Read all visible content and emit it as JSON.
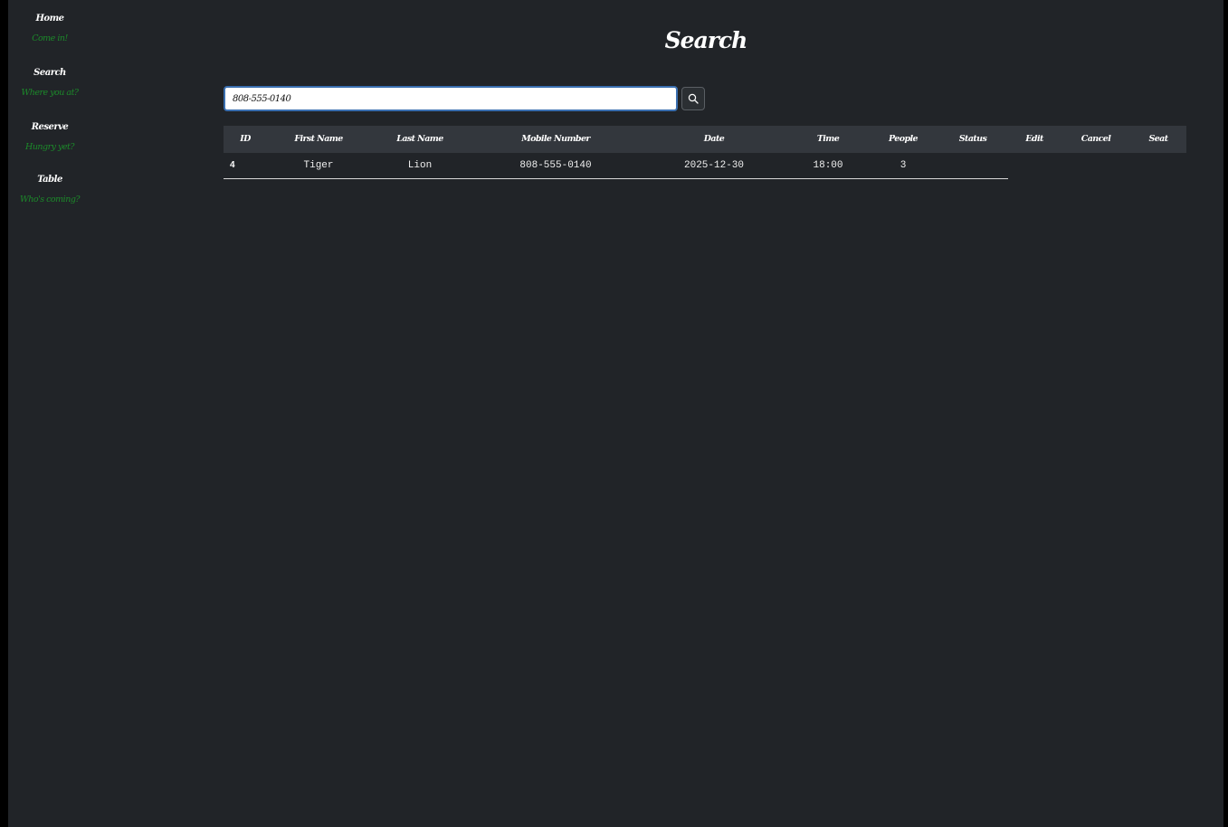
{
  "sidebar": {
    "items": [
      {
        "title": "Home",
        "subtitle": "Come in!"
      },
      {
        "title": "Search",
        "subtitle": "Where you at?"
      },
      {
        "title": "Reserve",
        "subtitle": "Hungry yet?"
      },
      {
        "title": "Table",
        "subtitle": "Who's coming?"
      }
    ]
  },
  "page": {
    "title": "Search"
  },
  "search": {
    "value": "808-555-0140",
    "button_icon": "search-icon"
  },
  "table": {
    "headers": [
      "ID",
      "First Name",
      "Last Name",
      "Mobile Number",
      "Date",
      "Time",
      "People",
      "Status",
      "Edit",
      "Cancel",
      "Seat"
    ],
    "rows": [
      {
        "id": "4",
        "first_name": "Tiger",
        "last_name": "Lion",
        "mobile": "808-555-0140",
        "date": "2025-12-30",
        "time": "18:00",
        "people": "3",
        "status": "",
        "edit": "",
        "cancel": "",
        "seat": ""
      }
    ]
  },
  "colors": {
    "background": "#212428",
    "header_bar": "#33373d",
    "nav_subtitle": "#1c8a2a",
    "input_border": "#3a6fb0"
  }
}
